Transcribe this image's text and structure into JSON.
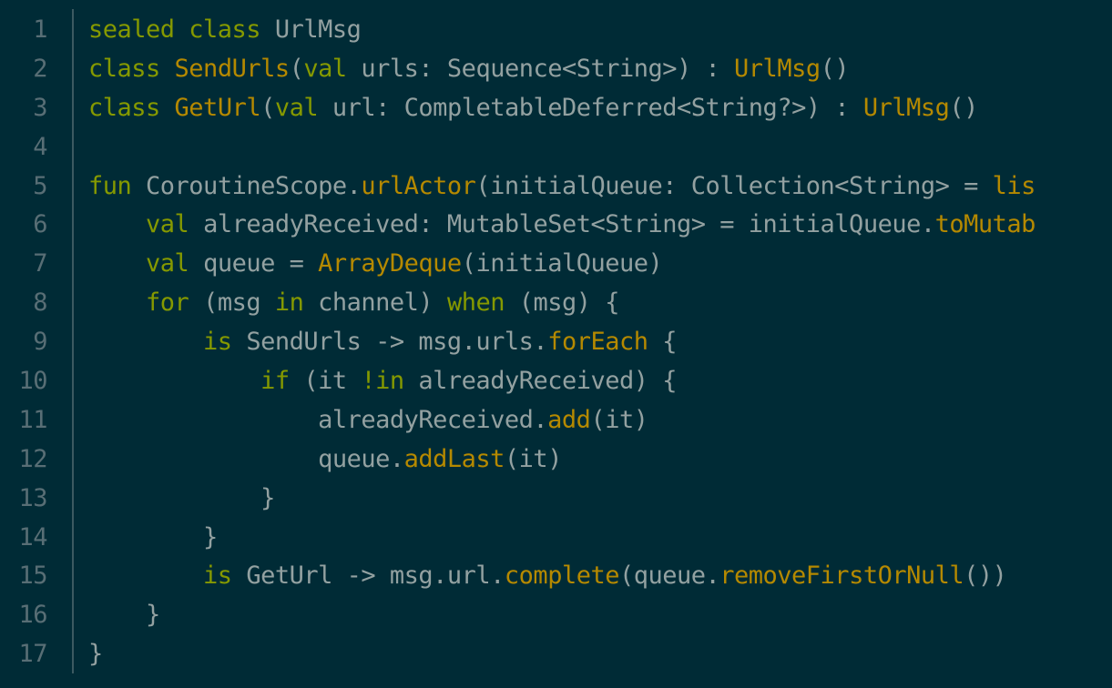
{
  "colors": {
    "background": "#002b36",
    "line_number": "#586e75",
    "gutter_divider": "#3c5a61",
    "keyword": "#859900",
    "identifier": "#93a1a1",
    "function": "#b58900"
  },
  "gutter": {
    "line_numbers": [
      "1",
      "2",
      "3",
      "4",
      "5",
      "6",
      "7",
      "8",
      "9",
      "10",
      "11",
      "12",
      "13",
      "14",
      "15",
      "16",
      "17"
    ]
  },
  "code": {
    "lines": [
      [
        {
          "t": "kw",
          "v": "sealed class"
        },
        {
          "t": "id",
          "v": " UrlMsg"
        }
      ],
      [
        {
          "t": "kw",
          "v": "class"
        },
        {
          "t": "id",
          "v": " "
        },
        {
          "t": "fn",
          "v": "SendUrls"
        },
        {
          "t": "id",
          "v": "("
        },
        {
          "t": "kw",
          "v": "val"
        },
        {
          "t": "id",
          "v": " urls: Sequence<String>) : "
        },
        {
          "t": "fn",
          "v": "UrlMsg"
        },
        {
          "t": "id",
          "v": "()"
        }
      ],
      [
        {
          "t": "kw",
          "v": "class"
        },
        {
          "t": "id",
          "v": " "
        },
        {
          "t": "fn",
          "v": "GetUrl"
        },
        {
          "t": "id",
          "v": "("
        },
        {
          "t": "kw",
          "v": "val"
        },
        {
          "t": "id",
          "v": " url: CompletableDeferred<String?>) : "
        },
        {
          "t": "fn",
          "v": "UrlMsg"
        },
        {
          "t": "id",
          "v": "()"
        }
      ],
      [],
      [
        {
          "t": "kw",
          "v": "fun"
        },
        {
          "t": "id",
          "v": " CoroutineScope."
        },
        {
          "t": "fn",
          "v": "urlActor"
        },
        {
          "t": "id",
          "v": "(initialQueue: Collection<String> = "
        },
        {
          "t": "fn",
          "v": "lis"
        }
      ],
      [
        {
          "t": "id",
          "v": "    "
        },
        {
          "t": "kw",
          "v": "val"
        },
        {
          "t": "id",
          "v": " alreadyReceived: MutableSet<String> = initialQueue."
        },
        {
          "t": "fn",
          "v": "toMutab"
        }
      ],
      [
        {
          "t": "id",
          "v": "    "
        },
        {
          "t": "kw",
          "v": "val"
        },
        {
          "t": "id",
          "v": " queue = "
        },
        {
          "t": "fn",
          "v": "ArrayDeque"
        },
        {
          "t": "id",
          "v": "(initialQueue)"
        }
      ],
      [
        {
          "t": "id",
          "v": "    "
        },
        {
          "t": "kw",
          "v": "for"
        },
        {
          "t": "id",
          "v": " (msg "
        },
        {
          "t": "kw",
          "v": "in"
        },
        {
          "t": "id",
          "v": " channel) "
        },
        {
          "t": "kw",
          "v": "when"
        },
        {
          "t": "id",
          "v": " (msg) {"
        }
      ],
      [
        {
          "t": "id",
          "v": "        "
        },
        {
          "t": "kw",
          "v": "is"
        },
        {
          "t": "id",
          "v": " SendUrls -> msg.urls."
        },
        {
          "t": "fn",
          "v": "forEach"
        },
        {
          "t": "id",
          "v": " {"
        }
      ],
      [
        {
          "t": "id",
          "v": "            "
        },
        {
          "t": "kw",
          "v": "if"
        },
        {
          "t": "id",
          "v": " (it "
        },
        {
          "t": "kw",
          "v": "!in"
        },
        {
          "t": "id",
          "v": " alreadyReceived) {"
        }
      ],
      [
        {
          "t": "id",
          "v": "                alreadyReceived."
        },
        {
          "t": "fn",
          "v": "add"
        },
        {
          "t": "id",
          "v": "(it)"
        }
      ],
      [
        {
          "t": "id",
          "v": "                queue."
        },
        {
          "t": "fn",
          "v": "addLast"
        },
        {
          "t": "id",
          "v": "(it)"
        }
      ],
      [
        {
          "t": "id",
          "v": "            }"
        }
      ],
      [
        {
          "t": "id",
          "v": "        }"
        }
      ],
      [
        {
          "t": "id",
          "v": "        "
        },
        {
          "t": "kw",
          "v": "is"
        },
        {
          "t": "id",
          "v": " GetUrl -> msg.url."
        },
        {
          "t": "fn",
          "v": "complete"
        },
        {
          "t": "id",
          "v": "(queue."
        },
        {
          "t": "fn",
          "v": "removeFirstOrNull"
        },
        {
          "t": "id",
          "v": "())"
        }
      ],
      [
        {
          "t": "id",
          "v": "    }"
        }
      ],
      [
        {
          "t": "id",
          "v": "}"
        }
      ]
    ]
  }
}
